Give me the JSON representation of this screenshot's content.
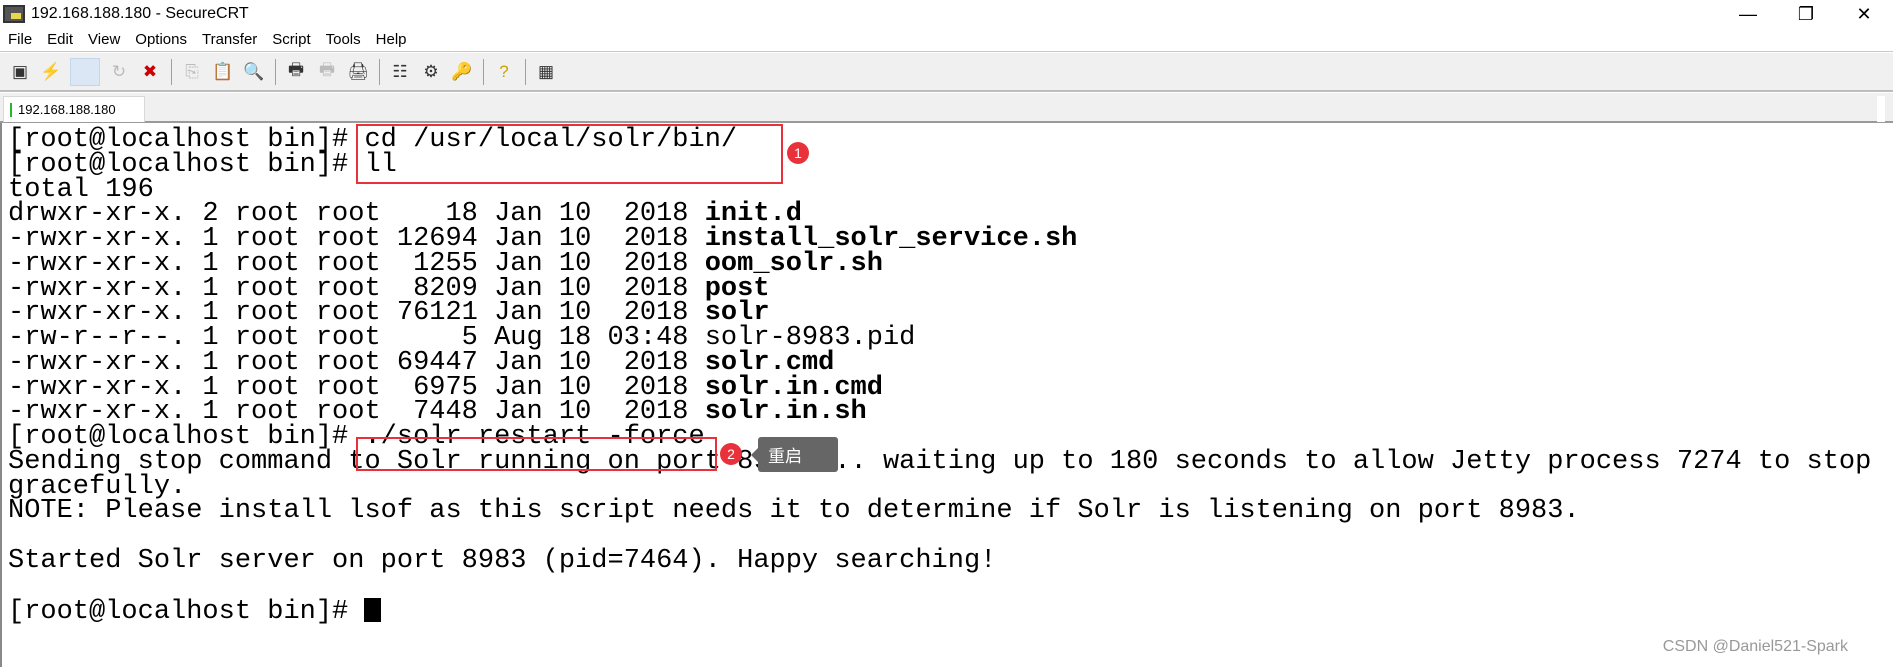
{
  "window": {
    "title": "192.168.188.180 - SecureCRT",
    "minimize": "—",
    "restore": "❐",
    "close": "✕"
  },
  "menu": [
    "File",
    "Edit",
    "View",
    "Options",
    "Transfer",
    "Script",
    "Tools",
    "Help"
  ],
  "toolbar": [
    {
      "icon": "connect-icon",
      "glyph": "▣"
    },
    {
      "icon": "quick-connect-icon",
      "glyph": "⚡"
    },
    {
      "icon": "connect-tab-icon",
      "glyph": ""
    },
    {
      "icon": "reconnect-icon",
      "glyph": "↻"
    },
    {
      "icon": "disconnect-icon",
      "glyph": "✖"
    },
    {
      "icon": "copy-icon",
      "glyph": "⎘"
    },
    {
      "icon": "paste-icon",
      "glyph": "📋"
    },
    {
      "icon": "find-icon",
      "glyph": "🔍"
    },
    {
      "icon": "print-icon",
      "glyph": "🖶"
    },
    {
      "icon": "print-selection-icon",
      "glyph": "🖶"
    },
    {
      "icon": "print-screen-icon",
      "glyph": "🖨"
    },
    {
      "icon": "session-options-icon",
      "glyph": "☷"
    },
    {
      "icon": "global-options-icon",
      "glyph": "⚙"
    },
    {
      "icon": "keymap-icon",
      "glyph": "🔑"
    },
    {
      "icon": "help-icon",
      "glyph": "?"
    },
    {
      "icon": "sftp-icon",
      "glyph": "▦"
    }
  ],
  "tab": {
    "label": "192.168.188.180",
    "status_color": "#2bb52b"
  },
  "terminal": {
    "lines": [
      [
        {
          "t": "[root@localhost bin]# cd /usr/local/solr/bin/"
        }
      ],
      [
        {
          "t": "[root@localhost bin]# ll"
        }
      ],
      [
        {
          "t": "total 196"
        }
      ],
      [
        {
          "t": "drwxr-xr-x. 2 root root    18 Jan 10  2018 "
        },
        {
          "t": "init.d",
          "b": true
        }
      ],
      [
        {
          "t": "-rwxr-xr-x. 1 root root 12694 Jan 10  2018 "
        },
        {
          "t": "install_solr_service.sh",
          "b": true
        }
      ],
      [
        {
          "t": "-rwxr-xr-x. 1 root root  1255 Jan 10  2018 "
        },
        {
          "t": "oom_solr.sh",
          "b": true
        }
      ],
      [
        {
          "t": "-rwxr-xr-x. 1 root root  8209 Jan 10  2018 "
        },
        {
          "t": "post",
          "b": true
        }
      ],
      [
        {
          "t": "-rwxr-xr-x. 1 root root 76121 Jan 10  2018 "
        },
        {
          "t": "solr",
          "b": true
        }
      ],
      [
        {
          "t": "-rw-r--r--. 1 root root     5 Aug 18 03:48 solr-8983.pid"
        }
      ],
      [
        {
          "t": "-rwxr-xr-x. 1 root root 69447 Jan 10  2018 "
        },
        {
          "t": "solr.cmd",
          "b": true
        }
      ],
      [
        {
          "t": "-rwxr-xr-x. 1 root root  6975 Jan 10  2018 "
        },
        {
          "t": "solr.in.cmd",
          "b": true
        }
      ],
      [
        {
          "t": "-rwxr-xr-x. 1 root root  7448 Jan 10  2018 "
        },
        {
          "t": "solr.in.sh",
          "b": true
        }
      ],
      [
        {
          "t": "[root@localhost bin]# ./solr restart -force"
        }
      ],
      [
        {
          "t": "Sending stop command to Solr running on port 8983 ... waiting up to 180 seconds to allow Jetty process 7274 to stop"
        }
      ],
      [
        {
          "t": "gracefully."
        }
      ],
      [
        {
          "t": "NOTE: Please install lsof as this script needs it to determine if Solr is listening on port 8983."
        }
      ],
      [
        {
          "t": ""
        }
      ],
      [
        {
          "t": "Started Solr server on port 8983 (pid=7464). Happy searching!"
        }
      ],
      [
        {
          "t": ""
        }
      ],
      [
        {
          "t": "[root@localhost bin]# "
        }
      ]
    ]
  },
  "annotations": {
    "badge1": "1",
    "badge2": "2",
    "tooltip": "重启",
    "color": "#e8313a"
  },
  "watermark": "CSDN @Daniel521-Spark"
}
